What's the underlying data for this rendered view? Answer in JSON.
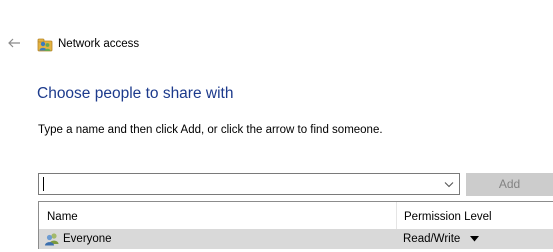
{
  "window": {
    "title": "Network access",
    "back_icon": "back-arrow-icon",
    "app_icon": "network-share-icon"
  },
  "main": {
    "heading": "Choose people to share with",
    "instructions": "Type a name and then click Add, or click the arrow to find someone."
  },
  "name_input": {
    "value": "",
    "dropdown_icon": "chevron-down-icon"
  },
  "add_button": {
    "label": "Add",
    "enabled": false
  },
  "share_list": {
    "columns": [
      "Name",
      "Permission Level"
    ],
    "rows": [
      {
        "name": "Everyone",
        "icon": "users-group-icon",
        "permission": "Read/Write",
        "selected": true
      }
    ]
  },
  "colors": {
    "heading": "#1c3a8c",
    "selected_row": "#d9d9d9",
    "disabled_button_bg": "#cccccc",
    "disabled_button_text": "#838383"
  }
}
